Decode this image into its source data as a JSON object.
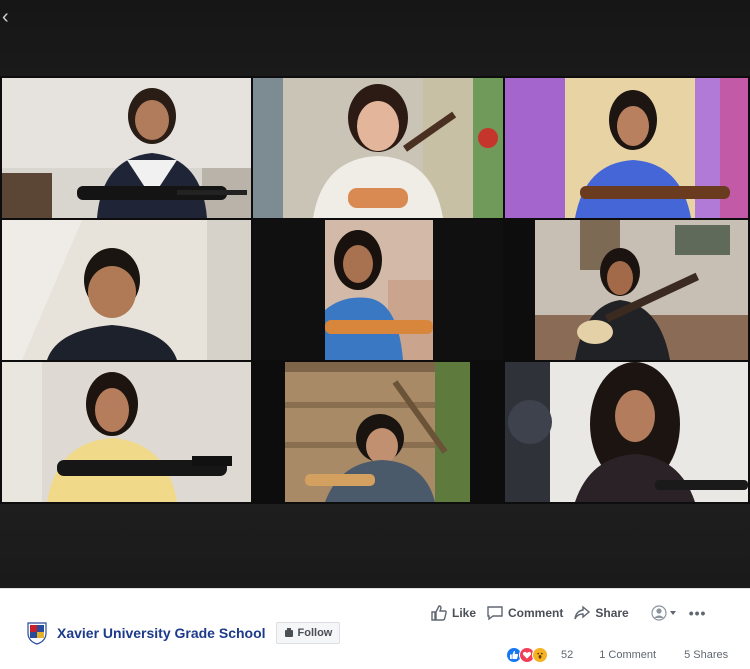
{
  "viewer": {
    "back_glyph": "‹"
  },
  "post": {
    "page_name": "Xavier University Grade School",
    "follow_label": "Follow",
    "actions": {
      "like_label": "Like",
      "comment_label": "Comment",
      "share_label": "Share"
    },
    "more_glyph": "•••",
    "reaction_count": "52",
    "comments_label": "1 Comment",
    "shares_label": "5 Shares"
  },
  "colors": {
    "page_name": "#1d3a8a",
    "like_blue": "#1877f2",
    "love_red": "#f33e58",
    "wow_yellow": "#f7b125"
  },
  "icons": [
    "back-icon",
    "like-icon",
    "comment-icon",
    "share-icon",
    "avatar-icon",
    "caret-icon",
    "more-icon",
    "follow-icon",
    "like-reaction-icon",
    "love-reaction-icon",
    "wow-reaction-icon"
  ]
}
